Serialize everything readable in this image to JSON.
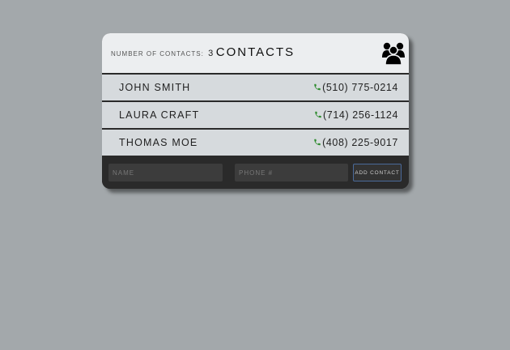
{
  "header": {
    "count_label": "NUMBER OF CONTACTS:",
    "count_value": "3",
    "title": "CONTACTS",
    "icon": "users-group-icon"
  },
  "contacts": [
    {
      "name": "JOHN SMITH",
      "phone": "(510) 775-0214"
    },
    {
      "name": "LAURA CRAFT",
      "phone": "(714) 256-1124"
    },
    {
      "name": "THOMAS MOE",
      "phone": "(408) 225-9017"
    }
  ],
  "form": {
    "name_placeholder": "NAME",
    "phone_placeholder": "PHONE #",
    "add_label": "ADD CONTACT"
  },
  "colors": {
    "background": "#a3a8ab",
    "header": "#eceef0",
    "row": "#d6dadd",
    "form": "#2a2a2a",
    "phone_icon": "#2e8b2e",
    "button_border": "#4a6a9a"
  }
}
